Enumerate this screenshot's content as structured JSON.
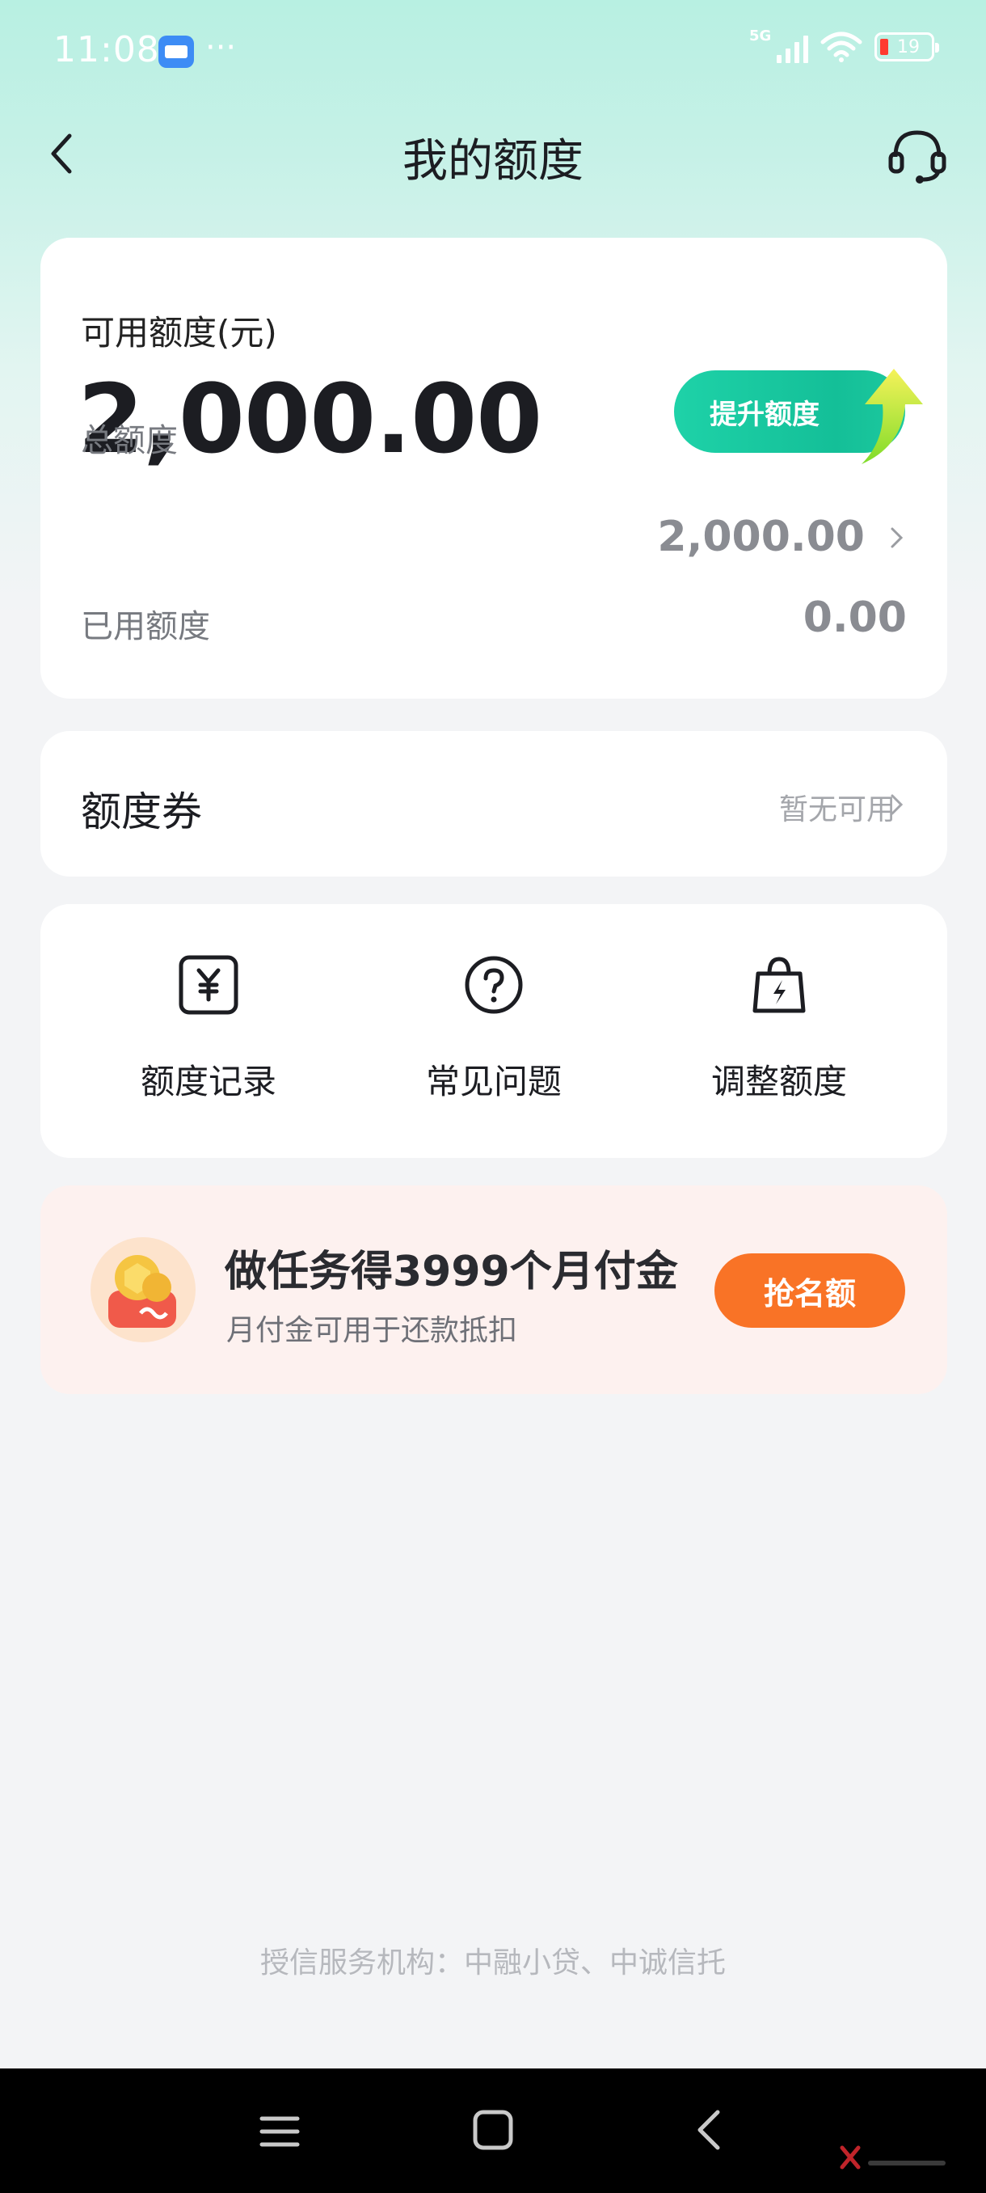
{
  "status_bar": {
    "time": "11:08",
    "dots": "···",
    "network": "5G",
    "battery": "19"
  },
  "header": {
    "title": "我的额度"
  },
  "credit": {
    "available_label": "可用额度(元)",
    "available_amount": "2,000.00",
    "raise_button": "提升额度",
    "total_label": "总额度",
    "total_value": "2,000.00",
    "used_label": "已用额度",
    "used_value": "0.00"
  },
  "coupon": {
    "title": "额度券",
    "status": "暂无可用"
  },
  "menu": [
    {
      "label": "额度记录",
      "icon": "yuan-record-icon"
    },
    {
      "label": "常见问题",
      "icon": "question-icon"
    },
    {
      "label": "调整额度",
      "icon": "bolt-bag-icon"
    }
  ],
  "promo": {
    "title": "做任务得3999个月付金",
    "subtitle": "月付金可用于还款抵扣",
    "button": "抢名额"
  },
  "footer": {
    "note": "授信服务机构：中融小贷、中诚信托"
  },
  "colors": {
    "accent_green": "#14bf98",
    "promo_orange": "#f97326",
    "promo_bg": "#fdf1ef"
  }
}
